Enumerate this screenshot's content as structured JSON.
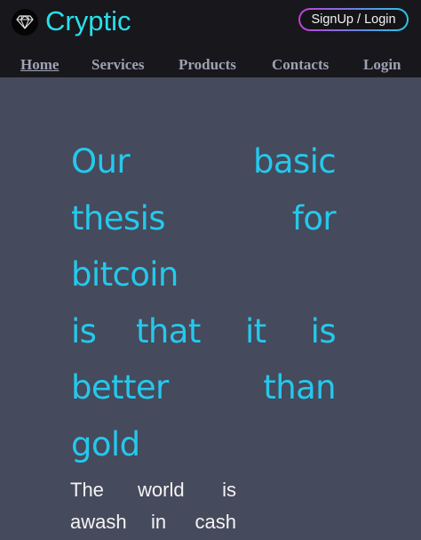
{
  "brand": {
    "name": "Cryptic",
    "logo_icon": "diamond-icon"
  },
  "header": {
    "signup_label": "SignUp / Login"
  },
  "nav": {
    "items": [
      {
        "label": "Home",
        "active": true
      },
      {
        "label": "Services",
        "active": false
      },
      {
        "label": "Products",
        "active": false
      },
      {
        "label": "Contacts",
        "active": false
      },
      {
        "label": "Login",
        "active": false
      }
    ]
  },
  "hero": {
    "lines": [
      [
        "Our",
        "basic"
      ],
      [
        "thesis",
        "for"
      ],
      [
        "bitcoin"
      ],
      [
        "is",
        "that",
        "it",
        "is"
      ],
      [
        "better",
        "than"
      ],
      [
        "gold"
      ]
    ]
  },
  "subtext": {
    "lines": [
      [
        "The",
        "world",
        "is"
      ],
      [
        "awash",
        "in",
        "cash"
      ]
    ]
  },
  "colors": {
    "header_bg": "#18171c",
    "page_bg": "#454a5c",
    "accent": "#27e0ea",
    "hero_text": "#25c8ec"
  }
}
